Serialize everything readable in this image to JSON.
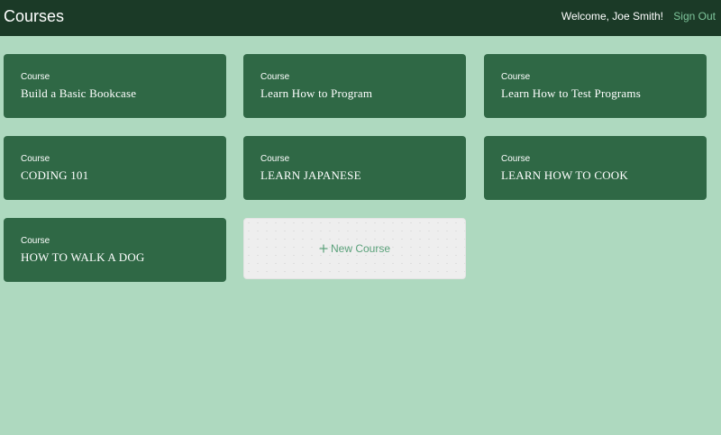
{
  "header": {
    "title": "Courses",
    "welcome": "Welcome, Joe Smith!",
    "sign_out": "Sign Out"
  },
  "courses": [
    {
      "label": "Course",
      "title": "Build a Basic Bookcase"
    },
    {
      "label": "Course",
      "title": "Learn How to Program"
    },
    {
      "label": "Course",
      "title": "Learn How to Test Programs"
    },
    {
      "label": "Course",
      "title": "CODING 101"
    },
    {
      "label": "Course",
      "title": "LEARN JAPANESE"
    },
    {
      "label": "Course",
      "title": "LEARN HOW TO COOK"
    },
    {
      "label": "Course",
      "title": "HOW TO WALK A DOG"
    }
  ],
  "new_course": {
    "icon": "plus-icon",
    "label": "New Course"
  },
  "colors": {
    "background": "#aed9bf",
    "header": "#1b3a27",
    "card": "#2f6845",
    "accent": "#7fc69c"
  }
}
